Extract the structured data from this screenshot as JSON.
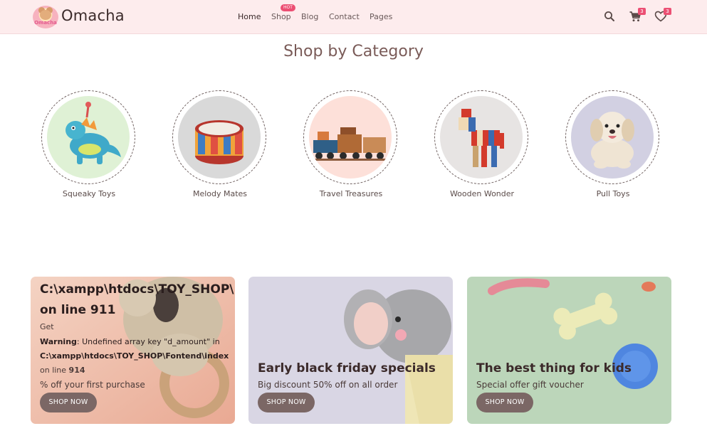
{
  "header": {
    "brand": "Omacha",
    "logo_text": "Omacha",
    "nav": [
      {
        "label": "Home",
        "active": true
      },
      {
        "label": "Shop",
        "badge": "HOT"
      },
      {
        "label": "Blog"
      },
      {
        "label": "Contact"
      },
      {
        "label": "Pages"
      }
    ],
    "icons": {
      "search": "search-icon",
      "cart": "cart-icon",
      "wishlist": "heart-icon"
    },
    "cart_count": "3",
    "wishlist_count": "3",
    "accent": "#ec4f73",
    "header_bg": "#fdeced"
  },
  "categories_section": {
    "title": "Shop by Category",
    "items": [
      {
        "label": "Squeaky Toys",
        "bg": "#dff1d5"
      },
      {
        "label": "Melody Mates",
        "bg": "#d9d9d9"
      },
      {
        "label": "Travel Treasures",
        "bg": "#fde0d9"
      },
      {
        "label": "Wooden Wonder",
        "bg": "#e7e4e3"
      },
      {
        "label": "Pull Toys",
        "bg": "#d2d0e2"
      }
    ]
  },
  "promo_cards": [
    {
      "error_line1": "C:\\xampp\\htdocs\\TOY_SHOP\\F",
      "error_line2": "on line 911",
      "text_get": "Get",
      "warning_label": "Warning",
      "warning_text": ": Undefined array key \"d_amount\" in",
      "path_text": "C:\\xampp\\htdocs\\TOY_SHOP\\Fontend\\index",
      "line_prefix": "on line ",
      "line_number": "914",
      "subtitle": "% off your first purchase",
      "button": "SHOP NOW"
    },
    {
      "title": "Early black friday specials",
      "subtitle": "Big discount 50% off on all order",
      "button": "SHOP NOW"
    },
    {
      "title": "The best thing for kids",
      "subtitle": "Special offer gift voucher",
      "button": "SHOP NOW"
    }
  ]
}
